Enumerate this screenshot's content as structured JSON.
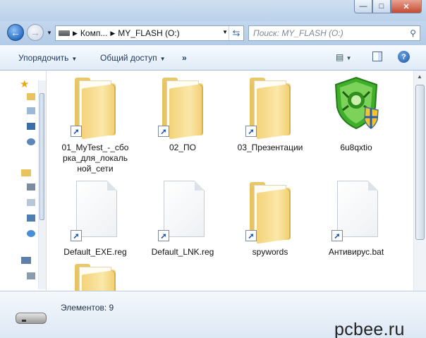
{
  "address": {
    "crumbs": [
      "Комп...",
      "MY_FLASH (O:)"
    ],
    "search_placeholder": "Поиск: MY_FLASH (O:)"
  },
  "toolbar": {
    "organize": "Упорядочить",
    "share": "Общий доступ",
    "more": "»"
  },
  "files": [
    {
      "name": "01_MyTest_-_сборка_для_локальной_сети",
      "line1": "01_MyTest_-_сбо",
      "line2": "рка_для_локаль",
      "line3": "ной_сети",
      "type": "folder",
      "shortcut": true
    },
    {
      "name": "02_ПО",
      "line1": "02_ПО",
      "type": "folder",
      "shortcut": true
    },
    {
      "name": "03_Презентации",
      "line1": "03_Презентации",
      "type": "folder",
      "shortcut": true
    },
    {
      "name": "6u8qxtio",
      "line1": "6u8qxtio",
      "type": "drweb-shield",
      "shortcut": false
    },
    {
      "name": "Default_EXE.reg",
      "line1": "Default_EXE.reg",
      "type": "document",
      "shortcut": true
    },
    {
      "name": "Default_LNK.reg",
      "line1": "Default_LNK.reg",
      "type": "document",
      "shortcut": true
    },
    {
      "name": "spywords",
      "line1": "spywords",
      "type": "folder",
      "shortcut": true
    },
    {
      "name": "Антивирус.bat",
      "line1": "Антивирус.bat",
      "type": "document",
      "shortcut": true
    },
    {
      "name": "",
      "type": "folder",
      "shortcut": false
    }
  ],
  "status": {
    "count_text": "Элементов: 9"
  },
  "watermark": "pcbee.ru",
  "colors": {
    "folder": "#f3d27a",
    "titlebar": "#b9d1ea",
    "drweb_green": "#3fae2a"
  }
}
